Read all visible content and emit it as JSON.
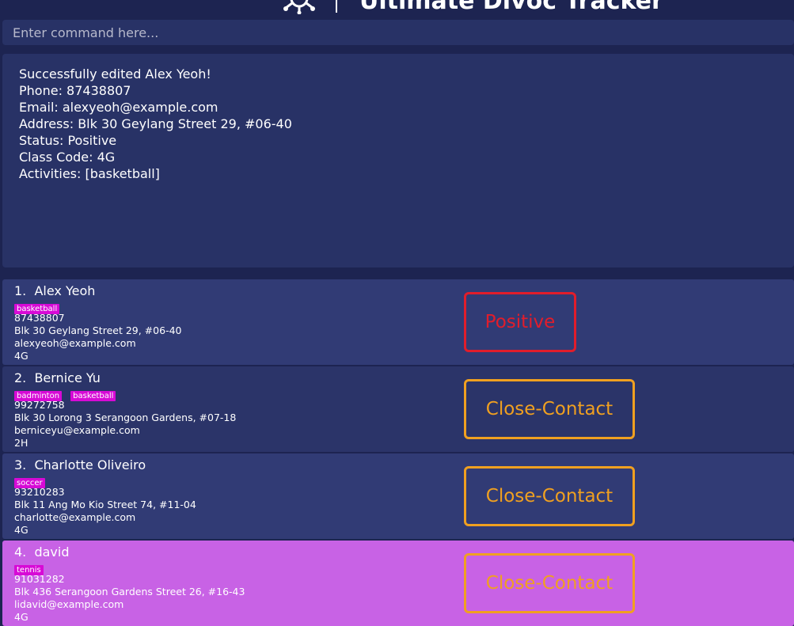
{
  "app": {
    "title": "Ultimate Divoc Tracker"
  },
  "command": {
    "placeholder": "Enter command here..."
  },
  "result": {
    "lines": [
      "Successfully edited Alex Yeoh!",
      "Phone: 87438807",
      "Email: alexyeoh@example.com",
      "Address: Blk 30 Geylang Street 29, #06-40",
      "Status: Positive",
      "Class Code: 4G",
      "Activities: [basketball]"
    ]
  },
  "persons": [
    {
      "index": "1.",
      "name": "Alex Yeoh",
      "tags": [
        "basketball"
      ],
      "phone": "87438807",
      "address": "Blk 30 Geylang Street 29, #06-40",
      "email": "alexyeoh@example.com",
      "class_code": "4G",
      "status": "Positive"
    },
    {
      "index": "2.",
      "name": "Bernice Yu",
      "tags": [
        "badminton",
        "basketball"
      ],
      "phone": "99272758",
      "address": "Blk 30 Lorong 3 Serangoon Gardens, #07-18",
      "email": "berniceyu@example.com",
      "class_code": "2H",
      "status": "Close-Contact"
    },
    {
      "index": "3.",
      "name": "Charlotte Oliveiro",
      "tags": [
        "soccer"
      ],
      "phone": "93210283",
      "address": "Blk 11 Ang Mo Kio Street 74, #11-04",
      "email": "charlotte@example.com",
      "class_code": "4G",
      "status": "Close-Contact"
    },
    {
      "index": "4.",
      "name": "david",
      "tags": [
        "tennis"
      ],
      "phone": "91031282",
      "address": "Blk 436 Serangoon Gardens Street 26, #16-43",
      "email": "lidavid@example.com",
      "class_code": "4G",
      "status": "Close-Contact"
    }
  ],
  "icons": {
    "logo": "virus-icon"
  },
  "colors": {
    "background": "#1d2451",
    "panel": "#283266",
    "card": "#313b75",
    "card_selected": "#c862e5",
    "tag": "#d70ad6",
    "status_positive": "#e11d2b",
    "status_close_contact": "#f0a020"
  }
}
